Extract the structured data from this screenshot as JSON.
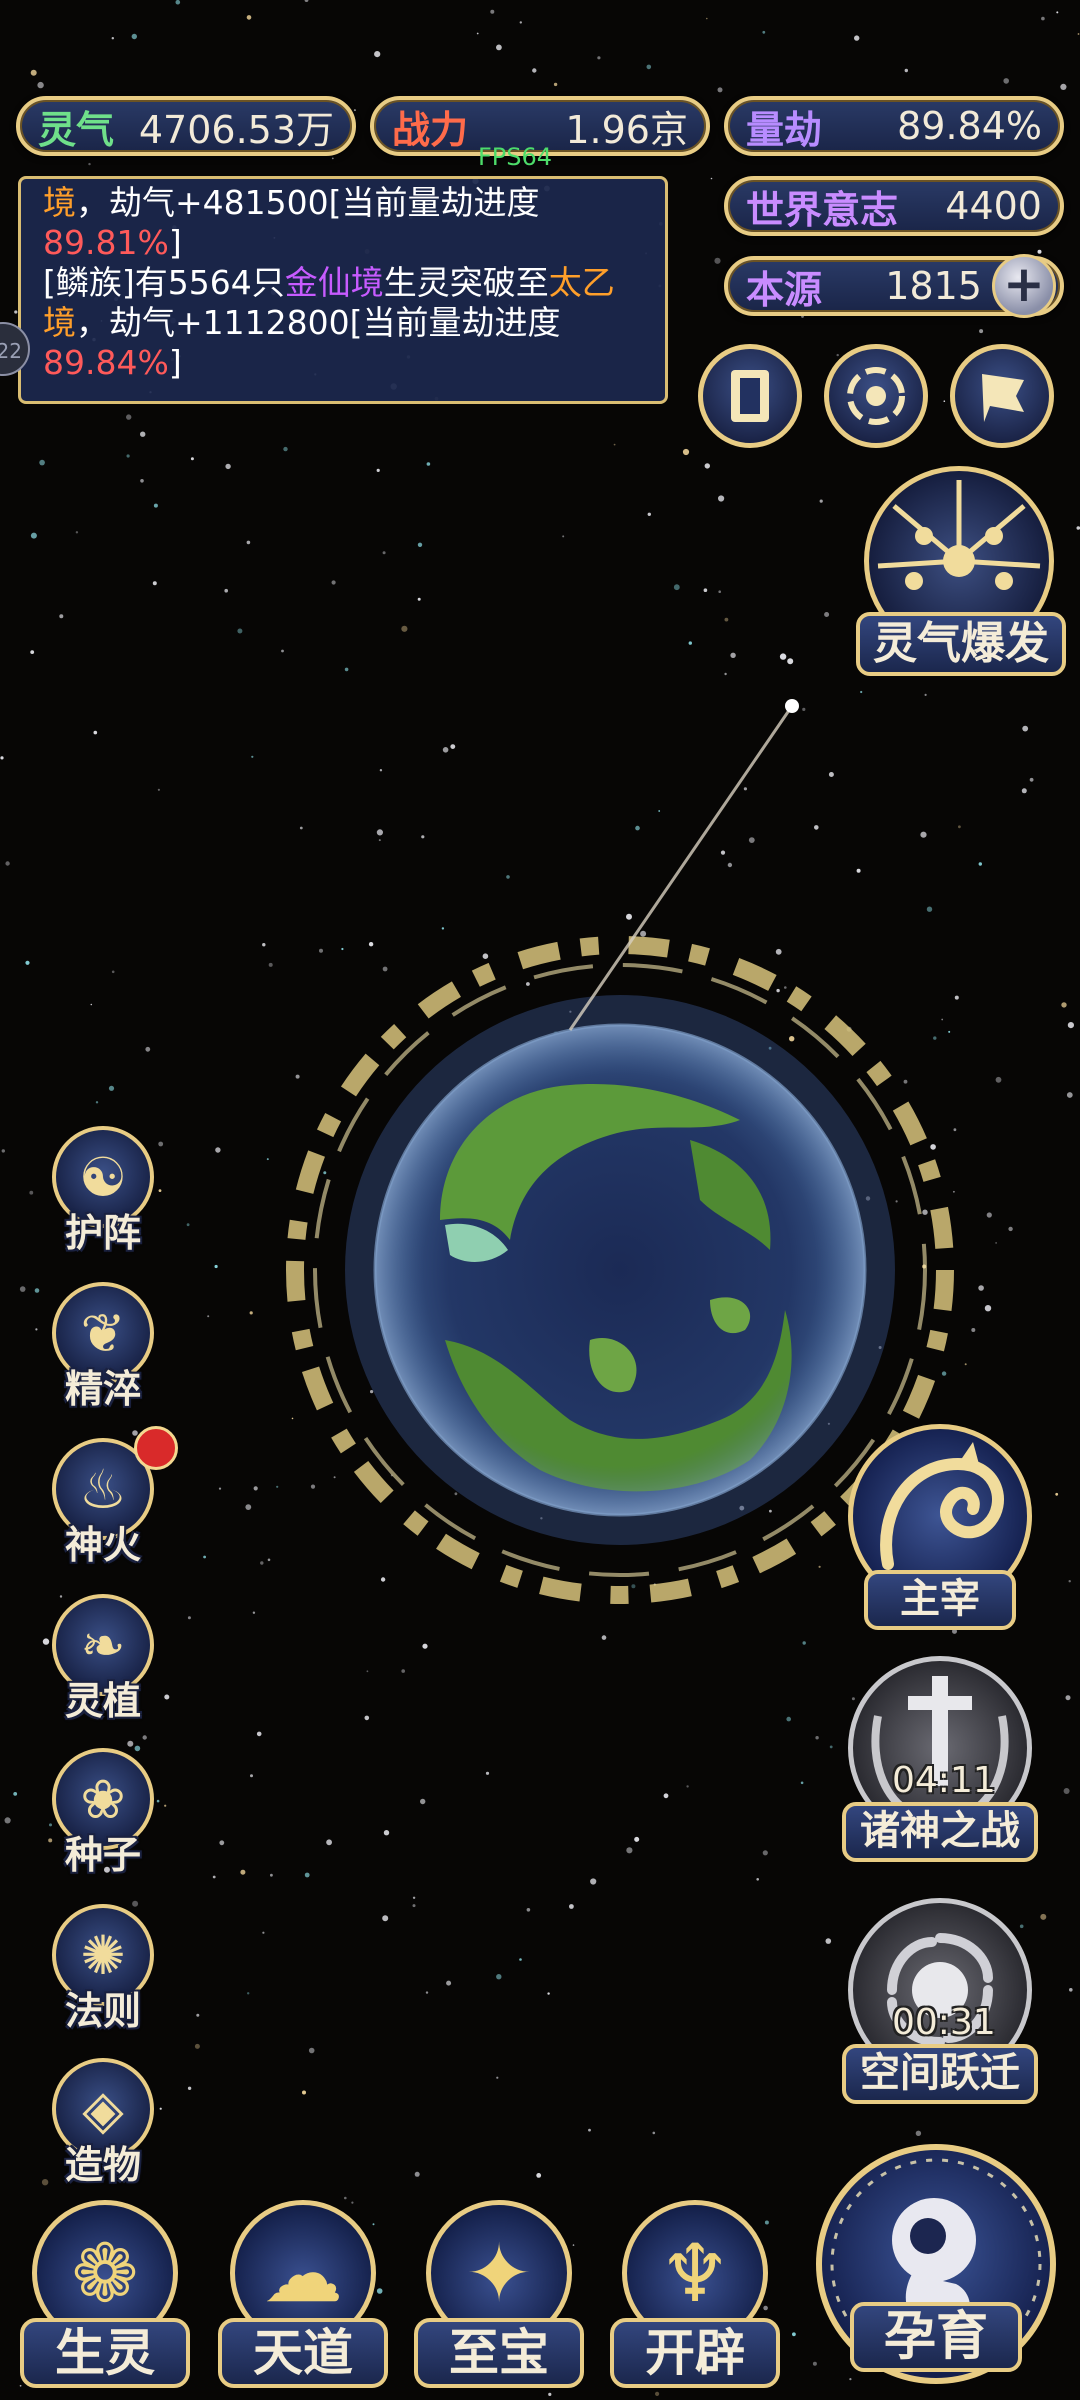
{
  "resources": {
    "lingqi": {
      "label": "灵气",
      "value": "4706.53万"
    },
    "zhanli": {
      "label": "战力",
      "value": "1.96京"
    },
    "liangjie": {
      "label": "量劫",
      "value": "89.84%"
    },
    "shijie_yizhi": {
      "label": "世界意志",
      "value": "4400"
    },
    "benyuan": {
      "label": "本源",
      "value": "1815"
    }
  },
  "fps": "FPS64",
  "side_tab": "22",
  "log": {
    "line1_a": "境",
    "line1_b": "，劫气+481500[当前量劫进度",
    "line1_pct": "89.81%",
    "line1_end": "]",
    "line2_a": "[鳞族]有5564只",
    "line2_realm1": "金仙境",
    "line2_b": "生灵突破至",
    "line2_realm2": "太乙",
    "line3_realm2b": "境",
    "line3_b": "，劫气+1112800[当前量劫进度",
    "line4_pct": "89.84%",
    "line4_end": "]"
  },
  "top_icons": [
    "book-icon",
    "vortex-icon",
    "flag-icon"
  ],
  "burst": {
    "label": "灵气爆发"
  },
  "left_menu": [
    {
      "label": "护阵",
      "icon": "taiji-icon",
      "glyph": "☯"
    },
    {
      "label": "精淬",
      "icon": "flame-lotus-icon",
      "glyph": "❦"
    },
    {
      "label": "神火",
      "icon": "fire-icon",
      "glyph": "♨"
    },
    {
      "label": "灵植",
      "icon": "plant-icon",
      "glyph": "❧"
    },
    {
      "label": "种子",
      "icon": "seed-icon",
      "glyph": "❀"
    },
    {
      "label": "法则",
      "icon": "beast-icon",
      "glyph": "✺"
    },
    {
      "label": "造物",
      "icon": "diamond-icon",
      "glyph": "◈"
    }
  ],
  "right_menu": {
    "zhuzai": {
      "label": "主宰"
    },
    "zhushen": {
      "label": "诸神之战",
      "timer": "04:11"
    },
    "kongjian": {
      "label": "空间跃迁",
      "timer": "00:31"
    }
  },
  "bottom_menu": [
    {
      "label": "生灵",
      "icon": "phoenix-icon",
      "glyph": "❁"
    },
    {
      "label": "天道",
      "icon": "cloud-icon",
      "glyph": "☁"
    },
    {
      "label": "至宝",
      "icon": "treasure-icon",
      "glyph": "✦"
    },
    {
      "label": "开辟",
      "icon": "flame-icon",
      "glyph": "♆"
    }
  ],
  "yunyu": {
    "label": "孕育"
  },
  "colors": {
    "gold": "#e8cc84",
    "panel": "#1c284e",
    "accent_red": "#ff5a5a",
    "accent_orange": "#ff9f2a",
    "accent_purple": "#c75bff"
  }
}
